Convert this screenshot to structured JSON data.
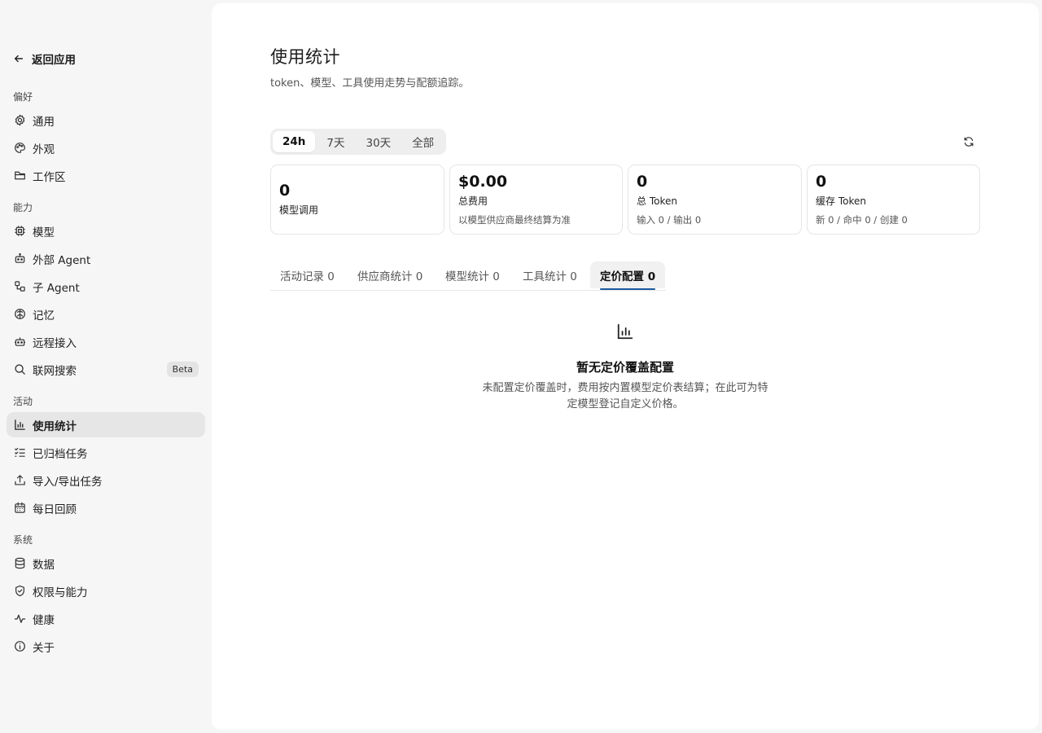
{
  "sidebar": {
    "back_label": "返回应用",
    "sections": {
      "preferences": "偏好",
      "capabilities": "能力",
      "activity": "活动",
      "system": "系统"
    },
    "items": {
      "general": "通用",
      "appearance": "外观",
      "workspace": "工作区",
      "models": "模型",
      "external_agent": "外部 Agent",
      "sub_agent": "子 Agent",
      "memory": "记忆",
      "remote_access": "远程接入",
      "web_search": "联网搜索",
      "web_search_badge": "Beta",
      "usage_stats": "使用统计",
      "archived_tasks": "已归档任务",
      "import_export": "导入/导出任务",
      "daily_review": "每日回顾",
      "data": "数据",
      "permissions": "权限与能力",
      "health": "健康",
      "about": "关于"
    },
    "active_item": "usage_stats"
  },
  "main": {
    "title": "使用统计",
    "subtitle": "token、模型、工具使用走势与配额追踪。",
    "ranges": [
      "24h",
      "7天",
      "30天",
      "全部"
    ],
    "active_range": "24h",
    "stats": {
      "calls_value": "0",
      "calls_label": "模型调用",
      "cost_value": "$0.00",
      "cost_label": "总费用",
      "cost_sub": "以模型供应商最终结算为准",
      "tokens_value": "0",
      "tokens_label": "总 Token",
      "tokens_sub": "输入 0 / 输出 0",
      "cache_value": "0",
      "cache_label": "缓存 Token",
      "cache_sub": "新 0 / 命中 0 / 创建 0"
    },
    "tabs": [
      "活动记录 0",
      "供应商统计 0",
      "模型统计 0",
      "工具统计 0",
      "定价配置 0"
    ],
    "active_tab": "定价配置 0",
    "empty": {
      "title": "暂无定价覆盖配置",
      "description": "未配置定价覆盖时，费用按内置模型定价表结算；在此可为特定模型登记自定义价格。"
    }
  },
  "colors": {
    "accent": "#1e5aa0",
    "sidebar_bg": "#f6f6f6",
    "active_bg": "#e6e6e6"
  }
}
